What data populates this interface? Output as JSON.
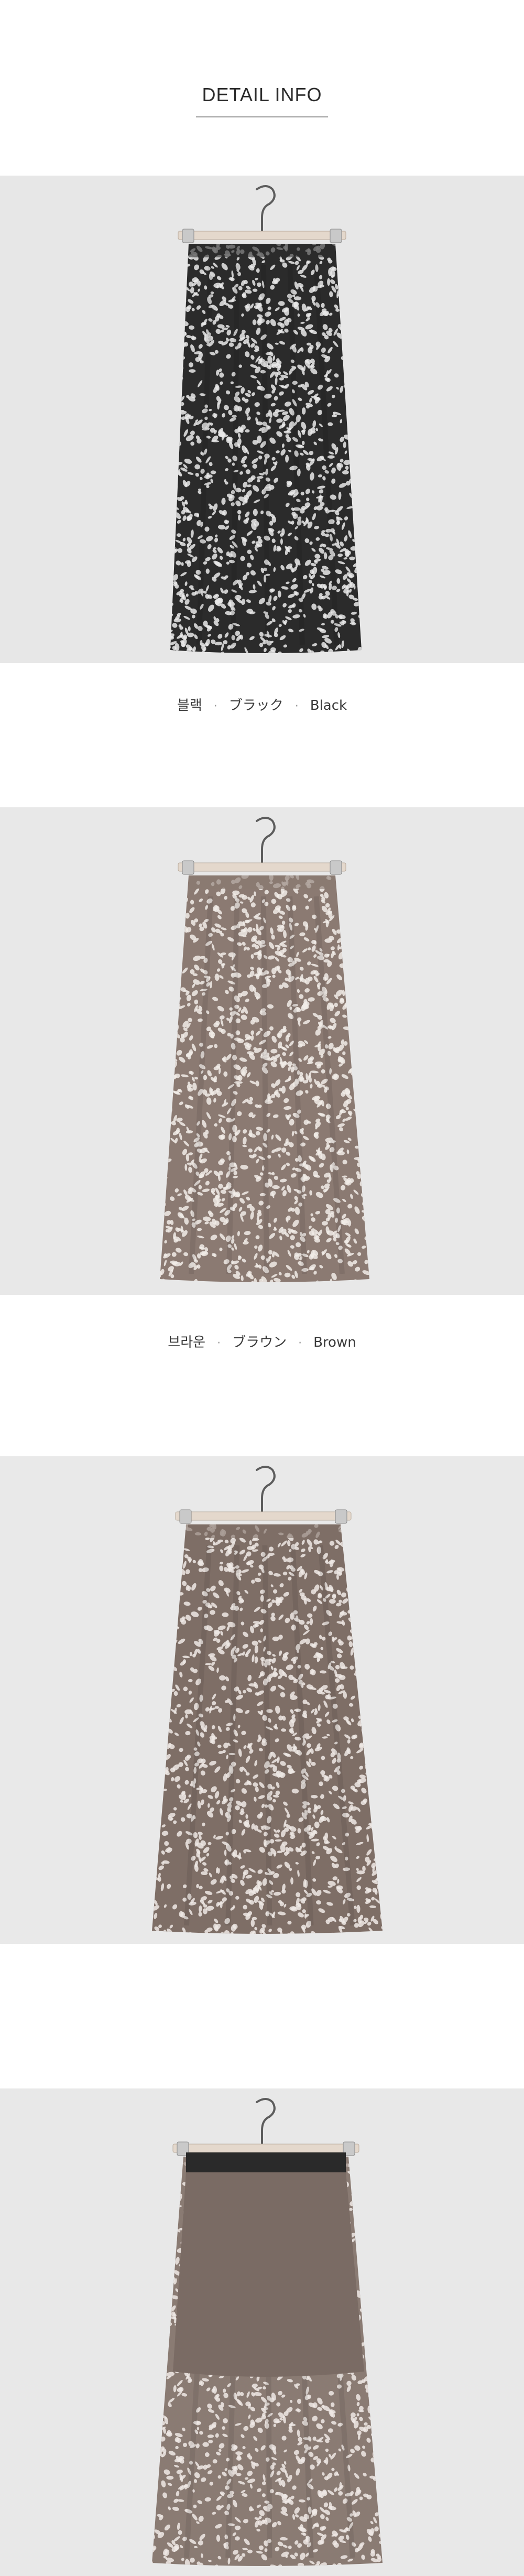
{
  "header": {
    "title": "DETAIL INFO"
  },
  "variants": [
    {
      "korean": "블랙",
      "japanese": "ブラック",
      "english": "Black",
      "fabric_color": "#2b2b2b",
      "dot_color": "#e9e9e9",
      "panel_color": "#e7e7e7"
    },
    {
      "korean": "브라운",
      "japanese": "ブラウン",
      "english": "Brown",
      "fabric_color": "#8b7a72",
      "dot_color": "#f1ece8",
      "panel_color": "#e8e8e8"
    },
    {
      "fabric_color": "#7e6e66",
      "dot_color": "#efe9e5",
      "panel_color": "#e9e9e9"
    },
    {
      "fabric_color": "#8a7b73",
      "dot_color": "#efe9e5",
      "lining_color": "#7a6b64",
      "waistband_color": "#2a2a2a",
      "panel_color": "#e8e8e8"
    }
  ],
  "separator": "·",
  "icons": {
    "hanger": "hanger-icon"
  }
}
